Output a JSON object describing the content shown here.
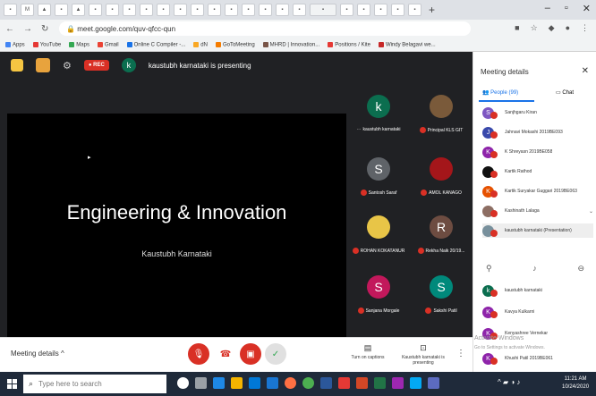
{
  "browser": {
    "url": "meet.google.com/quv-qfcc-qun",
    "bookmarks": [
      "Apps",
      "YouTube",
      "Maps",
      "Gmail",
      "Online C Compiler -...",
      "dN",
      "GoToMeeting",
      "MHRD | Innovation...",
      "Positions / Kite",
      "Windy Belagavi we..."
    ]
  },
  "meet_top": {
    "rec_label": "REC",
    "presenter_initial": "k",
    "presenting_text": "kaustubh karnataki is presenting"
  },
  "slide": {
    "title": "Engineering & Innovation",
    "subtitle": "Kaustubh Karnataki"
  },
  "tiles": [
    {
      "initial": "k",
      "name": "kaustubh karnataki",
      "color": "#0b6e4f"
    },
    {
      "initial": "",
      "name": "Principal KLS GIT",
      "color": "#7a5a3a"
    },
    {
      "initial": "S",
      "name": "Santosh Saraf",
      "color": "#5f6368"
    },
    {
      "initial": "",
      "name": "AMOL KANAGO",
      "color": "#a4161a"
    },
    {
      "initial": "",
      "name": "ROHAN KOKATANUR",
      "color": "#e8c547"
    },
    {
      "initial": "R",
      "name": "Rekha Naik 20/19...",
      "color": "#6d4c41"
    },
    {
      "initial": "S",
      "name": "Sanjana Morgale",
      "color": "#c2185b"
    },
    {
      "initial": "S",
      "name": "Sakshi Patil",
      "color": "#00897b"
    }
  ],
  "bottom_bar": {
    "meeting_details": "Meeting details",
    "captions": "Turn on captions",
    "presenting": "Kaustubh karnataki is presenting"
  },
  "panel": {
    "title": "Meeting details",
    "tab_people": "People (99)",
    "tab_chat": "Chat",
    "participants": [
      {
        "initial": "S",
        "name": "Sanjhgaru Kiran",
        "color": "#7e57c2"
      },
      {
        "initial": "J",
        "name": "Jahnavi Mokashi 2019BE093",
        "color": "#3949ab"
      },
      {
        "initial": "K",
        "name": "K Shreyasn 2019BE058",
        "color": "#8e24aa"
      },
      {
        "initial": "",
        "name": "Kartik Rathod",
        "color": "#111111"
      },
      {
        "initial": "K",
        "name": "Kartik Suryakar Guggari 2019BE063",
        "color": "#e65100"
      },
      {
        "initial": "",
        "name": "Kashinath Lalaga",
        "color": "#8d6e63"
      },
      {
        "initial": "",
        "name": "kaustubh karnataki (Presentation)",
        "color": "#78909c"
      },
      {
        "initial": "k",
        "name": "kaustubh karnataki",
        "color": "#0b6e4f"
      },
      {
        "initial": "K",
        "name": "Kavya Kulkarni",
        "color": "#8e24aa"
      },
      {
        "initial": "K",
        "name": "Kenyashree Vernekar",
        "color": "#8e24aa"
      },
      {
        "initial": "K",
        "name": "Khushi Patil 2019BE061",
        "color": "#8e24aa"
      }
    ]
  },
  "watermark": {
    "line1": "Activate Windows",
    "line2": "Go to Settings to activate Windows."
  },
  "taskbar": {
    "search_placeholder": "Type here to search",
    "time": "11:21 AM",
    "date": "10/24/2020"
  }
}
